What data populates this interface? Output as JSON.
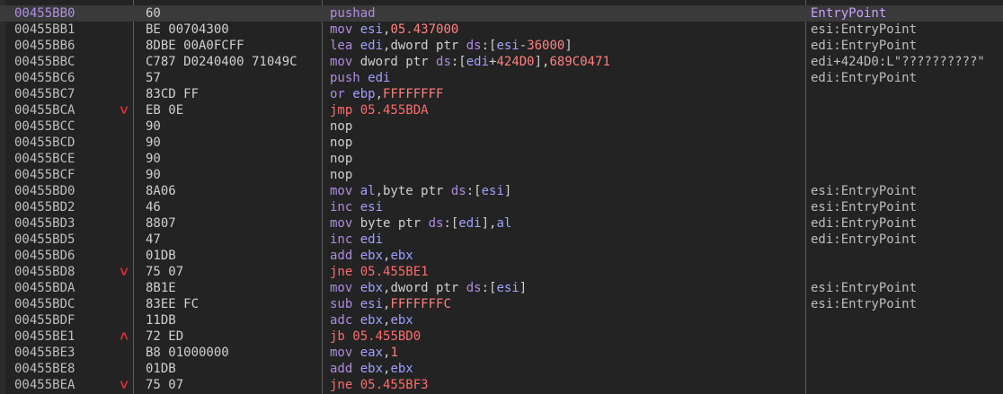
{
  "colors": {
    "mnemonic": "#b08be0",
    "jump": "#ff6b6b",
    "register": "#a0a0ff",
    "number": "#ff8080",
    "text": "#cfcfcf",
    "segment": "#b08be0",
    "comment": "#bdbdbd"
  },
  "rows": [
    {
      "addr": "00455BB0",
      "arrow": "",
      "bytes": "60",
      "asm": [
        [
          "pushad",
          "mn"
        ]
      ],
      "comment": "EntryPoint",
      "selected": true
    },
    {
      "addr": "00455BB1",
      "arrow": "",
      "bytes": "BE 00704300",
      "asm": [
        [
          "mov ",
          "mn"
        ],
        [
          "esi",
          "rg"
        ],
        [
          ",",
          "tx"
        ],
        [
          "05.437000",
          "nm"
        ]
      ],
      "comment": "esi:EntryPoint"
    },
    {
      "addr": "00455BB6",
      "arrow": "",
      "bytes": "8DBE 00A0FCFF",
      "asm": [
        [
          "lea ",
          "mn"
        ],
        [
          "edi",
          "rg"
        ],
        [
          ",dword ptr ",
          "tx"
        ],
        [
          "ds",
          "sg"
        ],
        [
          ":[",
          "tx"
        ],
        [
          "esi",
          "rg"
        ],
        [
          "-",
          "tx"
        ],
        [
          "36000",
          "nm"
        ],
        [
          "]",
          "tx"
        ]
      ],
      "comment": "edi:EntryPoint"
    },
    {
      "addr": "00455BBC",
      "arrow": "",
      "bytes": "C787 D0240400 71049C",
      "asm": [
        [
          "mov ",
          "mn"
        ],
        [
          "dword ptr ",
          "tx"
        ],
        [
          "ds",
          "sg"
        ],
        [
          ":[",
          "tx"
        ],
        [
          "edi",
          "rg"
        ],
        [
          "+",
          "tx"
        ],
        [
          "424D0",
          "nm"
        ],
        [
          "],",
          "tx"
        ],
        [
          "689C0471",
          "nm"
        ]
      ],
      "comment": "edi+424D0:L\"??????????\""
    },
    {
      "addr": "00455BC6",
      "arrow": "",
      "bytes": "57",
      "asm": [
        [
          "push ",
          "mn"
        ],
        [
          "edi",
          "rg"
        ]
      ],
      "comment": "edi:EntryPoint"
    },
    {
      "addr": "00455BC7",
      "arrow": "",
      "bytes": "83CD FF",
      "asm": [
        [
          "or ",
          "mn"
        ],
        [
          "ebp",
          "rg"
        ],
        [
          ",",
          "tx"
        ],
        [
          "FFFFFFFF",
          "nm"
        ]
      ],
      "comment": ""
    },
    {
      "addr": "00455BCA",
      "arrow": "down",
      "bytes": "EB 0E",
      "asm": [
        [
          "jmp ",
          "jp"
        ],
        [
          "05.455BDA",
          "jp"
        ]
      ],
      "comment": ""
    },
    {
      "addr": "00455BCC",
      "arrow": "",
      "bytes": "90",
      "asm": [
        [
          "nop",
          "tx"
        ]
      ],
      "comment": ""
    },
    {
      "addr": "00455BCD",
      "arrow": "",
      "bytes": "90",
      "asm": [
        [
          "nop",
          "tx"
        ]
      ],
      "comment": ""
    },
    {
      "addr": "00455BCE",
      "arrow": "",
      "bytes": "90",
      "asm": [
        [
          "nop",
          "tx"
        ]
      ],
      "comment": ""
    },
    {
      "addr": "00455BCF",
      "arrow": "",
      "bytes": "90",
      "asm": [
        [
          "nop",
          "tx"
        ]
      ],
      "comment": ""
    },
    {
      "addr": "00455BD0",
      "arrow": "",
      "bytes": "8A06",
      "asm": [
        [
          "mov ",
          "mn"
        ],
        [
          "al",
          "rg"
        ],
        [
          ",byte ptr ",
          "tx"
        ],
        [
          "ds",
          "sg"
        ],
        [
          ":[",
          "tx"
        ],
        [
          "esi",
          "rg"
        ],
        [
          "]",
          "tx"
        ]
      ],
      "comment": "esi:EntryPoint"
    },
    {
      "addr": "00455BD2",
      "arrow": "",
      "bytes": "46",
      "asm": [
        [
          "inc ",
          "mn"
        ],
        [
          "esi",
          "rg"
        ]
      ],
      "comment": "esi:EntryPoint"
    },
    {
      "addr": "00455BD3",
      "arrow": "",
      "bytes": "8807",
      "asm": [
        [
          "mov ",
          "mn"
        ],
        [
          "byte ptr ",
          "tx"
        ],
        [
          "ds",
          "sg"
        ],
        [
          ":[",
          "tx"
        ],
        [
          "edi",
          "rg"
        ],
        [
          "],",
          "tx"
        ],
        [
          "al",
          "rg"
        ]
      ],
      "comment": "edi:EntryPoint"
    },
    {
      "addr": "00455BD5",
      "arrow": "",
      "bytes": "47",
      "asm": [
        [
          "inc ",
          "mn"
        ],
        [
          "edi",
          "rg"
        ]
      ],
      "comment": "edi:EntryPoint"
    },
    {
      "addr": "00455BD6",
      "arrow": "",
      "bytes": "01DB",
      "asm": [
        [
          "add ",
          "mn"
        ],
        [
          "ebx",
          "rg"
        ],
        [
          ",",
          "tx"
        ],
        [
          "ebx",
          "rg"
        ]
      ],
      "comment": ""
    },
    {
      "addr": "00455BD8",
      "arrow": "down",
      "bytes": "75 07",
      "asm": [
        [
          "jne ",
          "jp"
        ],
        [
          "05.455BE1",
          "jp"
        ]
      ],
      "comment": ""
    },
    {
      "addr": "00455BDA",
      "arrow": "",
      "bytes": "8B1E",
      "asm": [
        [
          "mov ",
          "mn"
        ],
        [
          "ebx",
          "rg"
        ],
        [
          ",dword ptr ",
          "tx"
        ],
        [
          "ds",
          "sg"
        ],
        [
          ":[",
          "tx"
        ],
        [
          "esi",
          "rg"
        ],
        [
          "]",
          "tx"
        ]
      ],
      "comment": "esi:EntryPoint"
    },
    {
      "addr": "00455BDC",
      "arrow": "",
      "bytes": "83EE FC",
      "asm": [
        [
          "sub ",
          "mn"
        ],
        [
          "esi",
          "rg"
        ],
        [
          ",",
          "tx"
        ],
        [
          "FFFFFFFC",
          "nm"
        ]
      ],
      "comment": "esi:EntryPoint"
    },
    {
      "addr": "00455BDF",
      "arrow": "",
      "bytes": "11DB",
      "asm": [
        [
          "adc ",
          "mn"
        ],
        [
          "ebx",
          "rg"
        ],
        [
          ",",
          "tx"
        ],
        [
          "ebx",
          "rg"
        ]
      ],
      "comment": ""
    },
    {
      "addr": "00455BE1",
      "arrow": "up",
      "bytes": "72 ED",
      "asm": [
        [
          "jb ",
          "jp"
        ],
        [
          "05.455BD0",
          "jp"
        ]
      ],
      "comment": ""
    },
    {
      "addr": "00455BE3",
      "arrow": "",
      "bytes": "B8 01000000",
      "asm": [
        [
          "mov ",
          "mn"
        ],
        [
          "eax",
          "rg"
        ],
        [
          ",",
          "tx"
        ],
        [
          "1",
          "nm"
        ]
      ],
      "comment": ""
    },
    {
      "addr": "00455BE8",
      "arrow": "",
      "bytes": "01DB",
      "asm": [
        [
          "add ",
          "mn"
        ],
        [
          "ebx",
          "rg"
        ],
        [
          ",",
          "tx"
        ],
        [
          "ebx",
          "rg"
        ]
      ],
      "comment": ""
    },
    {
      "addr": "00455BEA",
      "arrow": "down",
      "bytes": "75 07",
      "asm": [
        [
          "jne ",
          "jp"
        ],
        [
          "05.455BF3",
          "jp"
        ]
      ],
      "comment": ""
    }
  ]
}
